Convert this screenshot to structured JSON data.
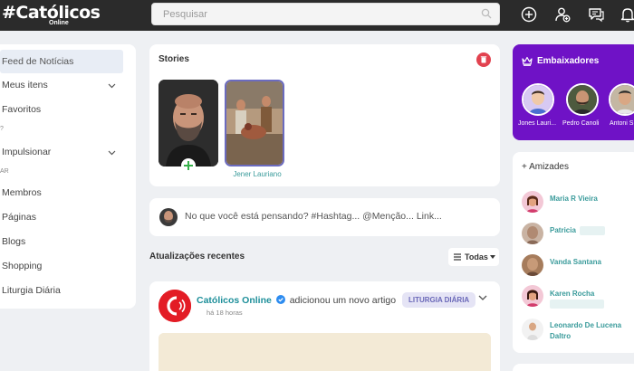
{
  "app": {
    "logo_text": "#Católicos",
    "logo_sub": "Online"
  },
  "search": {
    "placeholder": "Pesquisar",
    "value": ""
  },
  "sidebar": {
    "items": [
      {
        "label": "Feed de Notícias",
        "active": true
      },
      {
        "label": "Meus itens",
        "expandable": true
      },
      {
        "label": "Favoritos"
      },
      {
        "label": "Impulsionar",
        "expandable": true
      },
      {
        "label": "Membros"
      },
      {
        "label": "Páginas"
      },
      {
        "label": "Blogs"
      },
      {
        "label": "Shopping"
      },
      {
        "label": "Liturgia Diária"
      }
    ],
    "separators": [
      "?",
      "AR"
    ]
  },
  "stories": {
    "title": "Stories",
    "items": [
      {
        "caption": ""
      },
      {
        "caption": "Jener Lauriano"
      }
    ]
  },
  "composer": {
    "placeholder": "No que você está pensando? #Hashtag... @Menção... Link..."
  },
  "feed": {
    "section_title": "Atualizações recentes",
    "filter_label": "Todas",
    "post": {
      "author": "Católicos Online",
      "action": "adicionou um novo artigo",
      "badge": "LITURGIA DIÁRIA",
      "time": "há 18 horas"
    }
  },
  "ambassadors": {
    "title": "Embaixadores",
    "people": [
      {
        "name": "Jones Lauri..."
      },
      {
        "name": "Pedro Canoli"
      },
      {
        "name": "Antoni S"
      }
    ]
  },
  "friendships": {
    "title": "+ Amizades",
    "people": [
      {
        "name": "Maria R Vieira"
      },
      {
        "name": "Patricia"
      },
      {
        "name": "Vanda Santana"
      },
      {
        "name": "Karen Rocha"
      },
      {
        "name": "Leonardo De Lucena Daltro"
      }
    ]
  },
  "colors": {
    "topbar": "#2b2b2b",
    "accent_teal": "#1e8f9a",
    "ambassador_bg": "#6f12c6",
    "brand_red": "#e31c25"
  }
}
